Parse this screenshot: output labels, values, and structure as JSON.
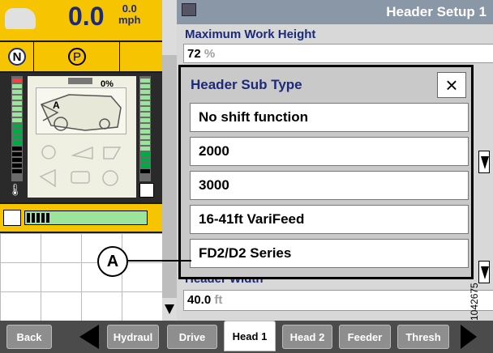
{
  "speed": {
    "value": "0.0",
    "unit": "mph",
    "small_value": "0.0"
  },
  "gear": {
    "neutral": "N",
    "park": "P"
  },
  "combine": {
    "percent": "0%",
    "marker": "A"
  },
  "header": {
    "title": "Header Setup 1"
  },
  "fields": {
    "max_work_height": {
      "label": "Maximum Work Height",
      "value": "72",
      "unit": "%"
    },
    "header_width": {
      "label": "Header Width",
      "value": "40.0",
      "unit": "ft"
    }
  },
  "dialog": {
    "title": "Header Sub Type",
    "close": "×",
    "options": [
      "No shift function",
      "2000",
      "3000",
      "16-41ft VariFeed",
      "FD2/D2 Series"
    ]
  },
  "callout": {
    "label": "A"
  },
  "figure_id": "1042675",
  "tabs": [
    {
      "label": "Back"
    },
    {
      "label": "Hydraul"
    },
    {
      "label": "Drive"
    },
    {
      "label": "Head 1"
    },
    {
      "label": "Head 2"
    },
    {
      "label": "Feeder"
    },
    {
      "label": "Thresh"
    }
  ],
  "colors": {
    "accent": "#f6c400",
    "label": "#1b2a7a",
    "title_bar": "#8a97a6",
    "tab_bg": "#4b4b4b"
  },
  "icons": [
    "car-icon",
    "neutral-gear-icon",
    "park-gear-icon",
    "combine-icon",
    "fuel-icon",
    "temperature-icon",
    "fan-icon",
    "unload-icon",
    "close-icon",
    "scroll-up-icon",
    "scroll-down-icon",
    "back-arrow-icon",
    "next-arrow-icon"
  ]
}
